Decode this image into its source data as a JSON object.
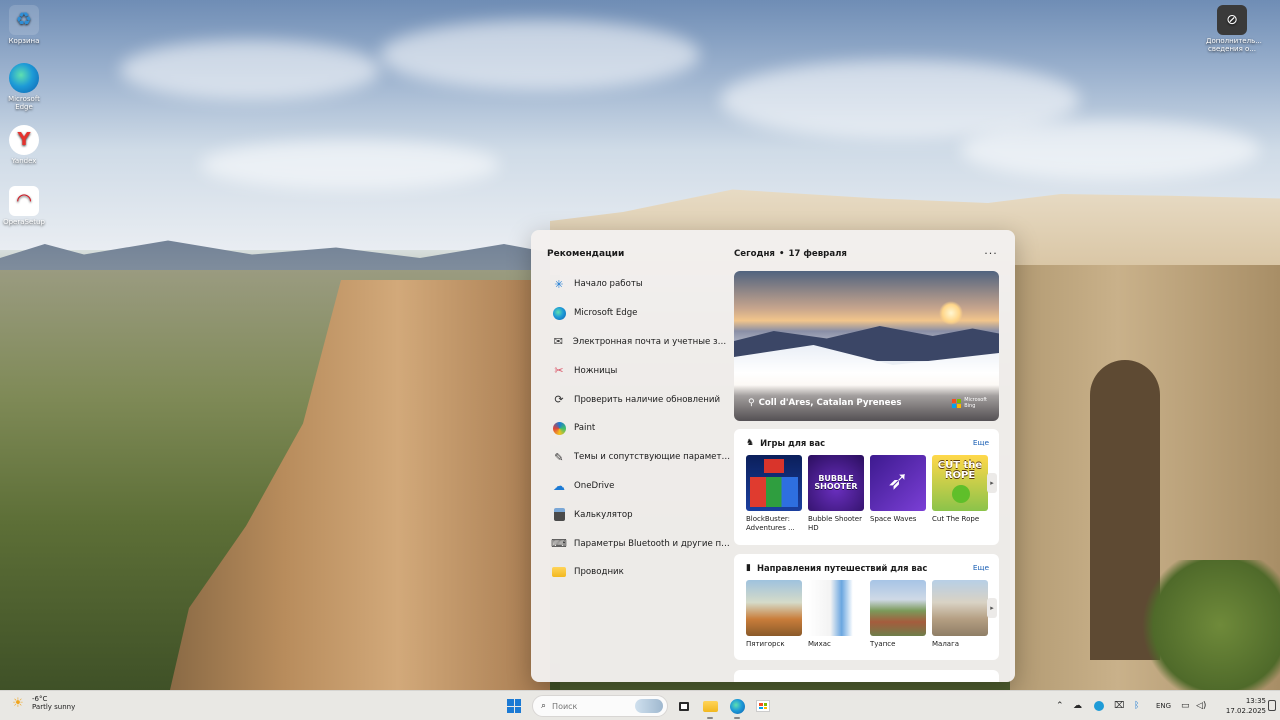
{
  "desktop": {
    "icons": [
      {
        "label": "Корзина",
        "icon": "recycle-bin-icon"
      },
      {
        "label": "Microsoft Edge",
        "icon": "edge-icon"
      },
      {
        "label": "Yandex",
        "icon": "yandex-icon"
      },
      {
        "label": "OperaSetup",
        "icon": "opera-icon"
      }
    ],
    "right_icon": {
      "label": "Дополнитель... сведения о...",
      "icon": "help-circle-icon"
    }
  },
  "widgets": {
    "recommendations_title": "Рекомендации",
    "recommendations": [
      {
        "label": "Начало работы",
        "icon": "get-started-icon"
      },
      {
        "label": "Microsoft Edge",
        "icon": "edge-icon"
      },
      {
        "label": "Электронная почта и учетные записи",
        "icon": "mail-icon"
      },
      {
        "label": "Ножницы",
        "icon": "scissors-icon"
      },
      {
        "label": "Проверить наличие обновлений",
        "icon": "refresh-icon"
      },
      {
        "label": "Paint",
        "icon": "paint-icon"
      },
      {
        "label": "Темы и сопутствующие параметры",
        "icon": "pen-icon"
      },
      {
        "label": "OneDrive",
        "icon": "onedrive-icon"
      },
      {
        "label": "Калькулятор",
        "icon": "calculator-icon"
      },
      {
        "label": "Параметры Bluetooth и другие пара...",
        "icon": "bluetooth-settings-icon"
      },
      {
        "label": "Проводник",
        "icon": "folder-icon"
      }
    ],
    "feed": {
      "today": "Сегодня",
      "date": "17 февраля",
      "more": "···",
      "hero": {
        "caption": "Coll d'Ares, Catalan Pyrenees",
        "brand_line1": "Microsoft",
        "brand_line2": "Bing"
      },
      "games": {
        "title": "Игры для вас",
        "more": "Еще",
        "items": [
          {
            "name": "BlockBuster: Adventures ...",
            "art_text": ""
          },
          {
            "name": "Bubble Shooter HD",
            "art_text": "BUBBLE SHOOTER"
          },
          {
            "name": "Space Waves",
            "art_text": ""
          },
          {
            "name": "Cut The Rope",
            "art_text": "CUT the ROPE"
          }
        ]
      },
      "travel": {
        "title": "Направления путешествий для вас",
        "more": "Еще",
        "items": [
          {
            "name": "Пятигорск"
          },
          {
            "name": "Михас"
          },
          {
            "name": "Туапсе"
          },
          {
            "name": "Малага"
          }
        ]
      }
    }
  },
  "taskbar": {
    "weather": {
      "temp": "-6°C",
      "condition": "Partly sunny"
    },
    "search_placeholder": "Поиск",
    "language": "ENG",
    "time": "13:35",
    "date": "17.02.2025"
  },
  "colors": {
    "accent": "#1b7ad4",
    "link": "#1a5fb4",
    "panel_bg": "#f3f0ee"
  }
}
